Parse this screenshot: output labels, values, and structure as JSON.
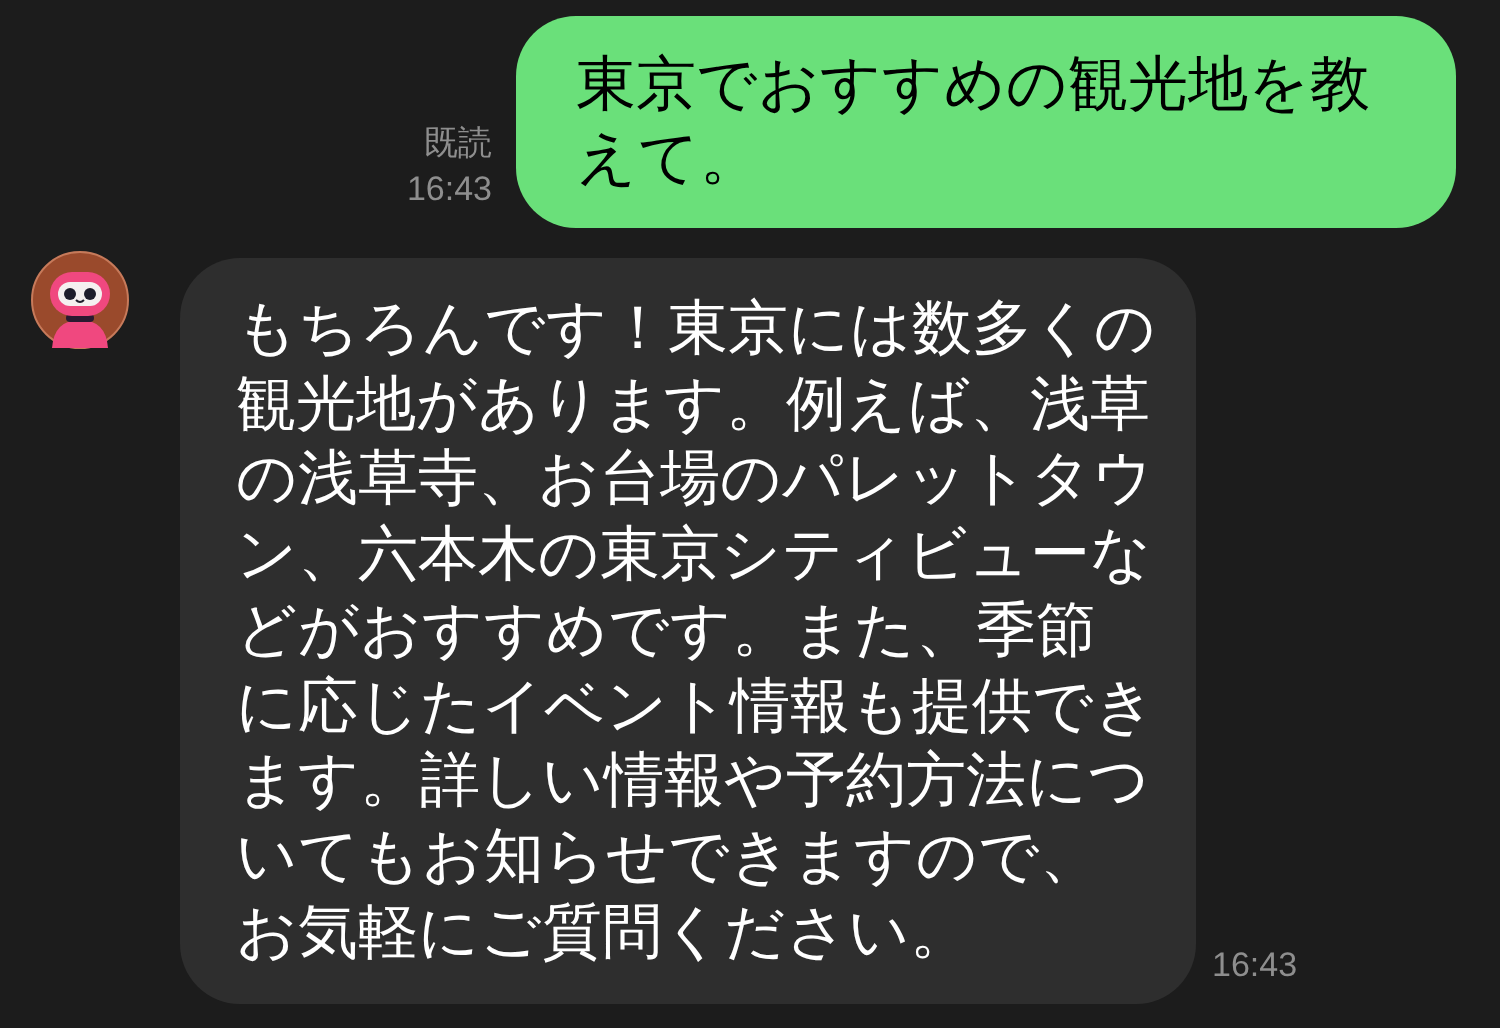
{
  "messages": [
    {
      "kind": "sent",
      "text": "東京でおすすめの観光地を教えて。",
      "read_label": "既読",
      "time": "16:43"
    },
    {
      "kind": "received",
      "text": "もちろんです！東京には数多くの観光地があります。例えば、浅草の浅草寺、お台場のパレットタウン、六本木の東京シティビューなどがおすすめです。また、季節に応じたイベント情報も提供できます。詳しい情報や予約方法についてもお知らせできますので、お気軽にご質問ください。",
      "time": "16:43"
    }
  ]
}
